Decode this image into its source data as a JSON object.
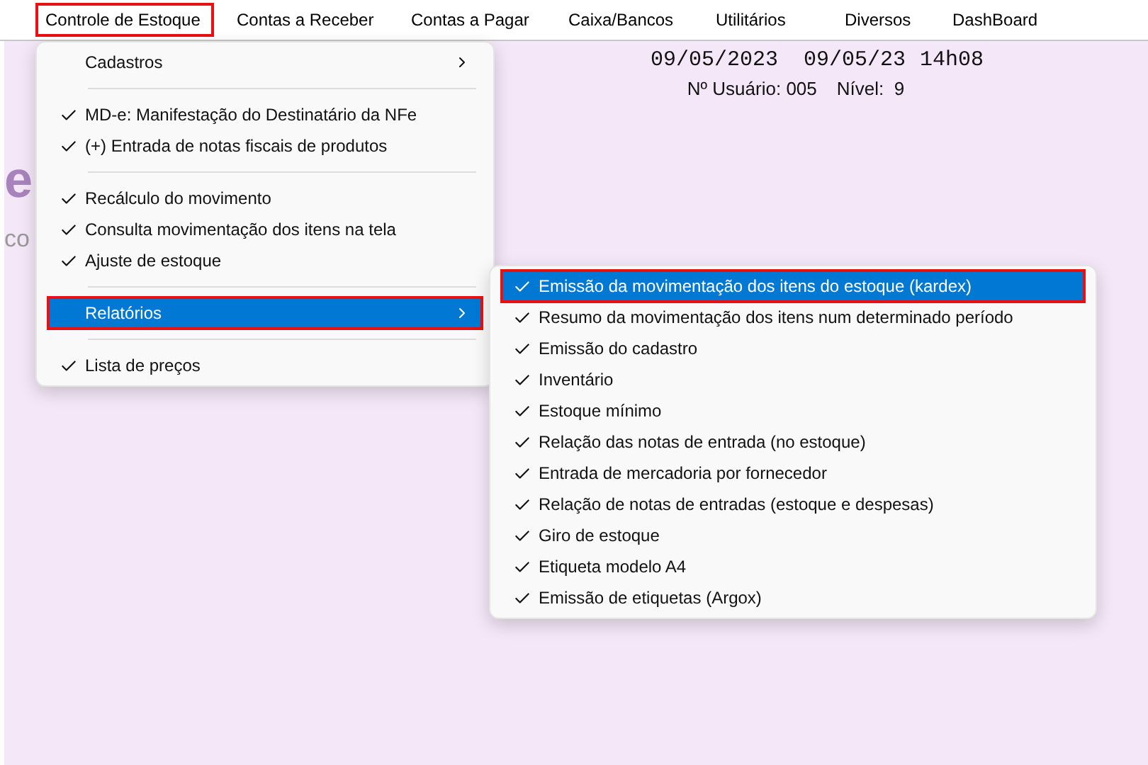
{
  "menu_bar": [
    {
      "label": "Controle de Estoque",
      "outlined": true
    },
    {
      "label": "Contas a Receber",
      "outlined": false
    },
    {
      "label": "Contas a Pagar",
      "outlined": false
    },
    {
      "label": "Caixa/Bancos",
      "outlined": false
    },
    {
      "label": "Utilitários",
      "outlined": false
    },
    {
      "label": "Diversos",
      "outlined": false
    },
    {
      "label": "DashBoard",
      "outlined": false
    }
  ],
  "background": {
    "logo_letter": "e",
    "logo_text": "co",
    "date": "09/05/2023",
    "date_short": "09/05/23",
    "time": "14h08",
    "user": "Nº Usuário: 005",
    "level": "Nível:  9"
  },
  "menu": {
    "items": [
      {
        "kind": "submenu",
        "label": "Cadastros",
        "checked": false,
        "selected": false,
        "outlined": false
      },
      {
        "kind": "separator"
      },
      {
        "kind": "item",
        "label": "MD-e: Manifestação do Destinatário da NFe",
        "checked": true,
        "selected": false,
        "outlined": false
      },
      {
        "kind": "item",
        "label": "(+) Entrada de notas fiscais de produtos",
        "checked": true,
        "selected": false,
        "outlined": false
      },
      {
        "kind": "separator"
      },
      {
        "kind": "item",
        "label": "Recálculo do movimento",
        "checked": true,
        "selected": false,
        "outlined": false
      },
      {
        "kind": "item",
        "label": "Consulta movimentação dos itens na tela",
        "checked": true,
        "selected": false,
        "outlined": false
      },
      {
        "kind": "item",
        "label": "Ajuste de estoque",
        "checked": true,
        "selected": false,
        "outlined": false
      },
      {
        "kind": "separator"
      },
      {
        "kind": "submenu",
        "label": "Relatórios",
        "checked": false,
        "selected": true,
        "outlined": true
      },
      {
        "kind": "separator"
      },
      {
        "kind": "item",
        "label": "Lista de preços",
        "checked": true,
        "selected": false,
        "outlined": false
      }
    ]
  },
  "submenu": {
    "items": [
      {
        "kind": "item",
        "label": "Emissão da movimentação dos itens do estoque (kardex)",
        "checked": true,
        "selected": true,
        "outlined": true
      },
      {
        "kind": "item",
        "label": "Resumo da movimentação dos itens num determinado período",
        "checked": true,
        "selected": false,
        "outlined": false
      },
      {
        "kind": "item",
        "label": "Emissão do cadastro",
        "checked": true,
        "selected": false,
        "outlined": false
      },
      {
        "kind": "item",
        "label": "Inventário",
        "checked": true,
        "selected": false,
        "outlined": false
      },
      {
        "kind": "item",
        "label": "Estoque mínimo",
        "checked": true,
        "selected": false,
        "outlined": false
      },
      {
        "kind": "item",
        "label": "Relação das notas de entrada (no estoque)",
        "checked": true,
        "selected": false,
        "outlined": false
      },
      {
        "kind": "item",
        "label": "Entrada de mercadoria por fornecedor",
        "checked": true,
        "selected": false,
        "outlined": false
      },
      {
        "kind": "item",
        "label": "Relação de notas de entradas (estoque e despesas)",
        "checked": true,
        "selected": false,
        "outlined": false
      },
      {
        "kind": "item",
        "label": "Giro de estoque",
        "checked": true,
        "selected": false,
        "outlined": false
      },
      {
        "kind": "item",
        "label": "Etiqueta modelo A4",
        "checked": true,
        "selected": false,
        "outlined": false
      },
      {
        "kind": "item",
        "label": "Emissão de etiquetas (Argox)",
        "checked": true,
        "selected": false,
        "outlined": false
      }
    ]
  }
}
